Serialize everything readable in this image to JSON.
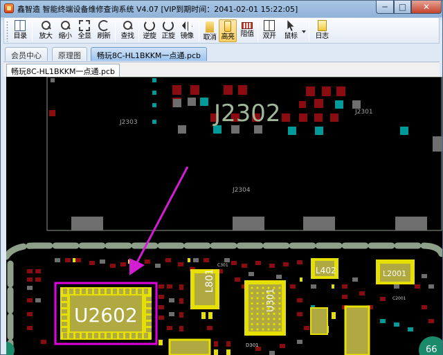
{
  "window": {
    "title": "鑫智造 智能终端设备维修查询系统 V4.07 [VIP到期时间：2041-02-01 15:22:05]",
    "icon": "app-logo-icon",
    "controls": {
      "minimize": "─",
      "maximize": "□",
      "close": "✕"
    }
  },
  "toolbar": {
    "items": [
      {
        "label": "目录",
        "icon": "book-icon"
      },
      {
        "label": "放大",
        "icon": "zoom-in-icon"
      },
      {
        "label": "缩小",
        "icon": "zoom-out-icon"
      },
      {
        "label": "全显",
        "icon": "fit-screen-icon"
      },
      {
        "label": "刷新",
        "icon": "refresh-icon"
      },
      {
        "label": "查找",
        "icon": "search-icon"
      },
      {
        "label": "逆旋",
        "icon": "rotate-ccw-icon"
      },
      {
        "label": "正旋",
        "icon": "rotate-cw-icon"
      },
      {
        "label": "镜像",
        "icon": "mirror-icon"
      },
      {
        "label": "取消",
        "icon": "cancel-icon"
      },
      {
        "label": "高亮",
        "icon": "highlight-icon",
        "active": true
      },
      {
        "label": "阻值",
        "icon": "resistance-icon"
      },
      {
        "label": "双开",
        "icon": "dual-open-icon"
      },
      {
        "label": "鼠标",
        "icon": "cursor-icon"
      },
      {
        "label": "日志",
        "icon": "log-icon"
      }
    ]
  },
  "tabs": {
    "top": [
      {
        "label": "会员中心",
        "active": false
      },
      {
        "label": "原理图",
        "active": false
      },
      {
        "label": "畅玩8C-HL1BKKM一点通.pcb",
        "active": true
      }
    ],
    "document": "畅玩8C-HL1BKKM一点通.pcb"
  },
  "pcb": {
    "labels": {
      "j2302": "J2302",
      "j2303": "J2303",
      "j2301": "J2301",
      "j2304": "J2304",
      "u2602": "U2602",
      "u301": "U301",
      "l801": "L801",
      "l402": "L402",
      "l2001": "L2001",
      "c2001": "C2001",
      "d301": "D301",
      "c301": "C301",
      "zoom_badge": "66"
    },
    "colors": {
      "background": "#000000",
      "pad_red": "#8b0c10",
      "pad_teal": "#009a9a",
      "pad_gray": "#6e6e6e",
      "pad_yellow": "#e6e000",
      "chip_body": "#b0a840",
      "outline_green": "#9aaa90",
      "highlight_magenta": "#e000e0",
      "arrow": "#d21ed2"
    }
  }
}
